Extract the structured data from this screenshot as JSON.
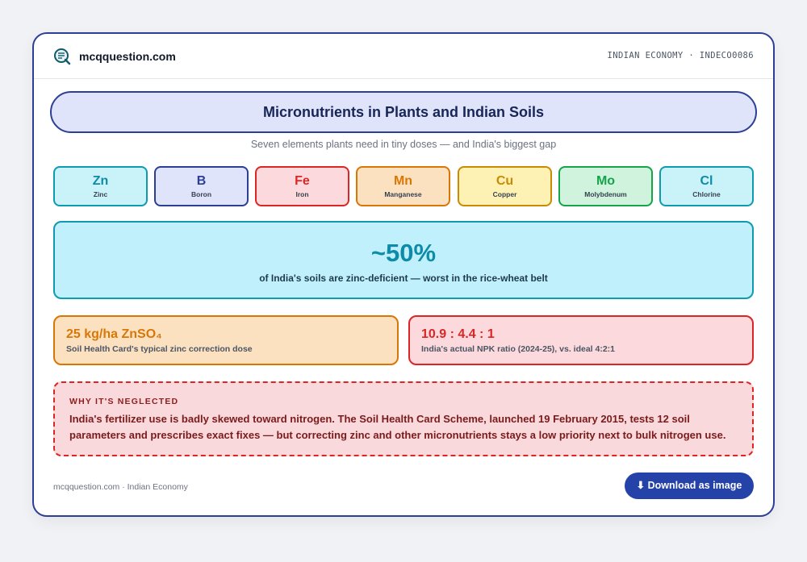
{
  "header": {
    "brand": "mcqquestion.com",
    "meta": "INDIAN ECONOMY · INDECO0086"
  },
  "title": "Micronutrients in Plants and Indian Soils",
  "subtitle": "Seven elements plants need in tiny doses — and India's biggest gap",
  "elements": [
    {
      "symbol": "Zn",
      "name": "Zinc",
      "bg": "#c9f2f9",
      "border": "#0e9bb0",
      "color": "#0e8ba8"
    },
    {
      "symbol": "B",
      "name": "Boron",
      "bg": "#dfe4fb",
      "border": "#2c3f94",
      "color": "#2c3f94"
    },
    {
      "symbol": "Fe",
      "name": "Iron",
      "bg": "#fbd9dc",
      "border": "#dc2626",
      "color": "#dc2626"
    },
    {
      "symbol": "Mn",
      "name": "Manganese",
      "bg": "#fce1c1",
      "border": "#d97706",
      "color": "#d97706"
    },
    {
      "symbol": "Cu",
      "name": "Copper",
      "bg": "#fdf2b3",
      "border": "#ca8a04",
      "color": "#ca8a04"
    },
    {
      "symbol": "Mo",
      "name": "Molybdenum",
      "bg": "#cff3dc",
      "border": "#16a34a",
      "color": "#16a34a"
    },
    {
      "symbol": "Cl",
      "name": "Chlorine",
      "bg": "#c9f2f9",
      "border": "#0e9bb0",
      "color": "#0e8ba8"
    }
  ],
  "highlight": {
    "value": "~50%",
    "caption": "of India's soils are zinc-deficient — worst in the rice-wheat belt"
  },
  "stats": [
    {
      "value": "25 kg/ha ZnSO₄",
      "caption": "Soil Health Card's typical zinc correction dose",
      "bg": "#fce1c1",
      "border": "#d97706",
      "color": "#d97706"
    },
    {
      "value": "10.9 : 4.4 : 1",
      "caption": "India's actual NPK ratio (2024-25), vs. ideal 4:2:1",
      "bg": "#fbd9dc",
      "border": "#dc2626",
      "color": "#dc2626"
    }
  ],
  "why": {
    "heading": "WHY IT'S NEGLECTED",
    "text": "India's fertilizer use is badly skewed toward nitrogen. The Soil Health Card Scheme, launched 19 February 2015, tests 12 soil parameters and prescribes exact fixes — but correcting zinc and other micronutrients stays a low priority next to bulk nitrogen use."
  },
  "footer": {
    "text": "mcqquestion.com · Indian Economy",
    "download_label": "⬇ Download as image"
  }
}
